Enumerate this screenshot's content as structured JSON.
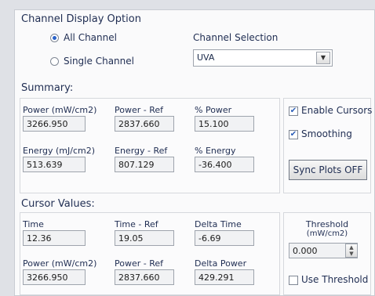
{
  "channel_display": {
    "title": "Channel Display Option",
    "all_channel_label": "All Channel",
    "single_channel_label": "Single Channel",
    "selected": "all",
    "channel_selection_label": "Channel Selection",
    "channel_selection_value": "UVA"
  },
  "summary": {
    "title": "Summary:",
    "power_label": "Power (mW/cm2)",
    "power_value": "3266.950",
    "power_ref_label": "Power - Ref",
    "power_ref_value": "2837.660",
    "pct_power_label": "% Power",
    "pct_power_value": "15.100",
    "energy_label": "Energy (mJ/cm2)",
    "energy_value": "513.639",
    "energy_ref_label": "Energy - Ref",
    "energy_ref_value": "807.129",
    "pct_energy_label": "% Energy",
    "pct_energy_value": "-36.400",
    "enable_cursors_label": "Enable Cursors",
    "enable_cursors_checked": true,
    "smoothing_label": "Smoothing",
    "smoothing_checked": true,
    "sync_plots_label": "Sync Plots OFF"
  },
  "cursor_values": {
    "title": "Cursor Values:",
    "time_label": "Time",
    "time_value": "12.36",
    "time_ref_label": "Time - Ref",
    "time_ref_value": "19.05",
    "delta_time_label": "Delta Time",
    "delta_time_value": "-6.69",
    "power_label": "Power (mW/cm2)",
    "power_value": "3266.950",
    "power_ref_label": "Power - Ref",
    "power_ref_value": "2837.660",
    "delta_power_label": "Delta Power",
    "delta_power_value": "429.291",
    "threshold_label": "Threshold",
    "threshold_unit": "(mW/cm2)",
    "threshold_value": "0.000",
    "use_threshold_label": "Use Threshold",
    "use_threshold_checked": false
  }
}
